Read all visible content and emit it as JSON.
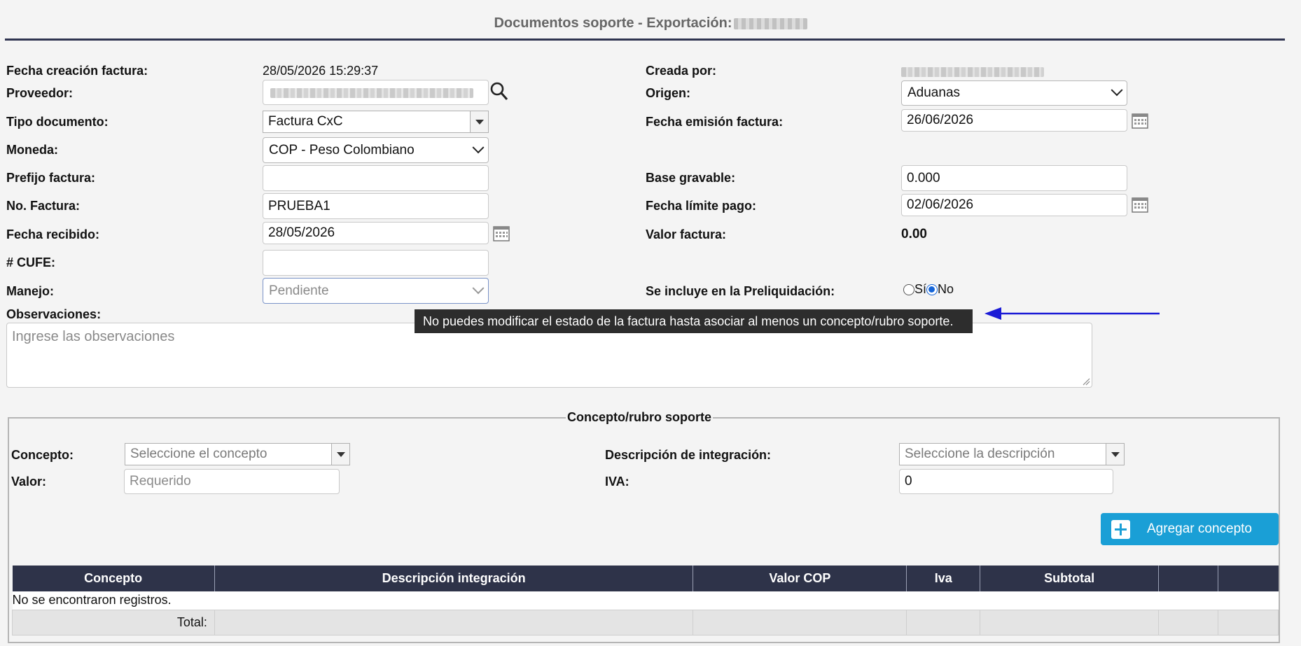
{
  "header": {
    "title": "Documentos soporte - Exportación:"
  },
  "left_fields": {
    "fecha_creacion_label": "Fecha creación factura:",
    "fecha_creacion_value": "28/05/2026 15:29:37",
    "proveedor_label": "Proveedor:",
    "tipo_doc_label": "Tipo documento:",
    "tipo_doc_value": "Factura CxC",
    "moneda_label": "Moneda:",
    "moneda_value": "COP - Peso Colombiano",
    "prefijo_label": "Prefijo factura:",
    "prefijo_value": "",
    "no_factura_label": "No. Factura:",
    "no_factura_value": "PRUEBA1",
    "fecha_recibido_label": "Fecha recibido:",
    "fecha_recibido_value": "28/05/2026",
    "cufe_label": "# CUFE:",
    "cufe_value": "",
    "manejo_label": "Manejo:",
    "manejo_value": "Pendiente",
    "observaciones_label": "Observaciones:",
    "observaciones_placeholder": "Ingrese las observaciones"
  },
  "right_fields": {
    "creada_por_label": "Creada por:",
    "origen_label": "Origen:",
    "origen_value": "Aduanas",
    "fecha_emision_label": "Fecha emisión factura:",
    "fecha_emision_value": "26/06/2026",
    "base_gravable_label": "Base gravable:",
    "base_gravable_value": "0.000",
    "fecha_limite_label": "Fecha límite pago:",
    "fecha_limite_value": "02/06/2026",
    "valor_factura_label": "Valor factura:",
    "valor_factura_value": "0.00",
    "preliq_label": "Se incluye en la Preliquidación:",
    "radio_si": "Sí",
    "radio_no": "No",
    "radio_selected": "No"
  },
  "tooltip": {
    "text": "No puedes modificar el estado de la factura hasta asociar al menos un concepto/rubro soporte."
  },
  "concepto": {
    "legend": "Concepto/rubro soporte",
    "concepto_label": "Concepto:",
    "concepto_placeholder": "Seleccione el concepto",
    "valor_label": "Valor:",
    "valor_placeholder": "Requerido",
    "descripcion_label": "Descripción de integración:",
    "descripcion_placeholder": "Seleccione la descripción",
    "iva_label": "IVA:",
    "iva_value": "0",
    "add_button": "Agregar concepto"
  },
  "table": {
    "headers": [
      "Concepto",
      "Descripción integración",
      "Valor COP",
      "Iva",
      "Subtotal",
      "",
      ""
    ],
    "empty_message": "No se encontraron registros.",
    "total_label": "Total:"
  },
  "colors": {
    "accent": "#1a9fd6",
    "header_dark": "#2e3349",
    "arrow": "#1a1ad6",
    "radio": "#1565d8"
  }
}
